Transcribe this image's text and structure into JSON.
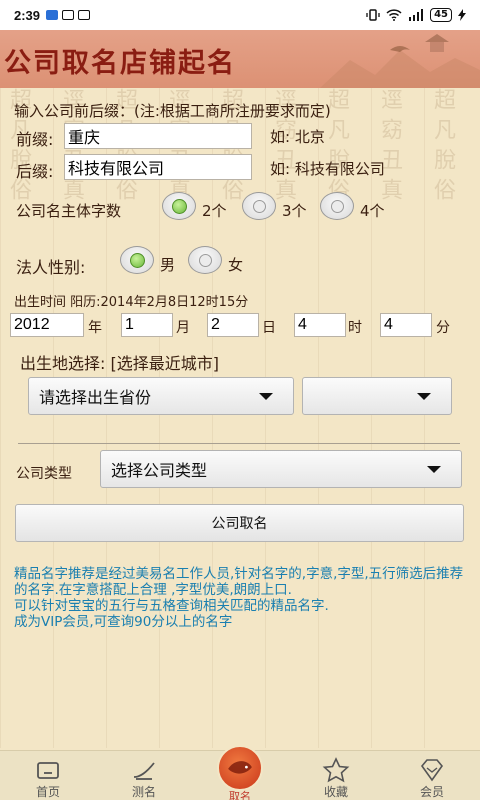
{
  "statusbar": {
    "time": "2:39",
    "battery": "45"
  },
  "header": {
    "title": "公司取名店铺起名"
  },
  "bg_columns": [
    "超凡脫俗",
    "逕窈丑真",
    "超凡脫俗",
    "逕窈丑真",
    "超凡脫俗",
    "逕窈丑真",
    "超凡脫俗",
    "逕窈丑真",
    "超凡脫俗"
  ],
  "form": {
    "prefix_suffix_title": "输入公司前后缀：(注:根据工商所注册要求而定)",
    "prefix_label": "前缀:",
    "prefix_value": "重庆",
    "prefix_example": "如:  北京",
    "suffix_label": "后缀:",
    "suffix_value": "科技有限公司",
    "suffix_example": "如:  科技有限公司",
    "char_count_label": "公司名主体字数",
    "char_count_options": [
      "2个",
      "3个",
      "4个"
    ],
    "char_count_selected": "2个",
    "gender_label": "法人性别:",
    "gender_options": [
      "男",
      "女"
    ],
    "gender_selected": "男",
    "birth_label": "出生时间 阳历:2014年2月8日12时15分",
    "birth_year": "2012",
    "birth_month": "1",
    "birth_day": "2",
    "birth_hour": "4",
    "birth_minute": "4",
    "unit_year": "年",
    "unit_month": "月",
    "unit_day": "日",
    "unit_hour": "时",
    "unit_minute": "分",
    "birthplace_label": "出生地选择: [选择最近城市]",
    "province_placeholder": "请选择出生省份",
    "city_value": "",
    "company_type_label": "公司类型",
    "company_type_value": "选择公司类型",
    "submit_label": "公司取名"
  },
  "info_text": [
    "精品名字推荐是经过美易名工作人员,针对名字的,字意,字型,五行筛选后推荐的名字.在字意搭配上合理 ,字型优美,朗朗上口.",
    "可以针对宝宝的五行与五格查询相关匹配的精品名字.",
    "成为VIP会员,可查询90分以上的名字"
  ],
  "bottom_nav": {
    "items": [
      {
        "label": "首页",
        "icon": "home-icon"
      },
      {
        "label": "测名",
        "icon": "brush-icon"
      },
      {
        "label": "取名",
        "icon": "fish-icon",
        "active": true
      },
      {
        "label": "收藏",
        "icon": "star-icon"
      },
      {
        "label": "会员",
        "icon": "diamond-icon"
      }
    ]
  },
  "colors": {
    "accent": "#c0392b",
    "info": "#1a7fb0",
    "header": "#dc9174",
    "background": "#f3e6c6"
  }
}
